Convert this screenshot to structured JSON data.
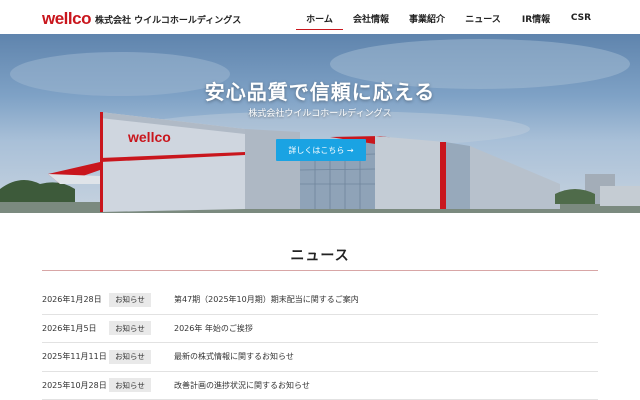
{
  "header": {
    "logo_mark": "wellco",
    "company_name": "株式会社 ウイルコホールディングス",
    "nav": [
      {
        "label": "ホーム",
        "active": true
      },
      {
        "label": "会社情報",
        "active": false
      },
      {
        "label": "事業紹介",
        "active": false
      },
      {
        "label": "ニュース",
        "active": false
      },
      {
        "label": "IR情報",
        "active": false
      },
      {
        "label": "CSR",
        "active": false
      }
    ]
  },
  "hero": {
    "title": "安心品質で信頼に応える",
    "subtitle": "株式会社ウイルコホールディングス",
    "button_label": "詳しくはこちら →",
    "building_sign": "wellco"
  },
  "news": {
    "title": "ニュース",
    "items": [
      {
        "date": "2026年1月28日",
        "category": "お知らせ",
        "text": "第47期（2025年10月期）期末配当に関するご案内"
      },
      {
        "date": "2026年1月5日",
        "category": "お知らせ",
        "text": "2026年 年始のご挨拶"
      },
      {
        "date": "2025年11月11日",
        "category": "お知らせ",
        "text": "最新の株式情報に関するお知らせ"
      },
      {
        "date": "2025年10月28日",
        "category": "お知らせ",
        "text": "改善計画の進捗状況に関するお知らせ"
      }
    ]
  },
  "colors": {
    "brand": "#c9161d",
    "button": "#1aa3e3"
  }
}
